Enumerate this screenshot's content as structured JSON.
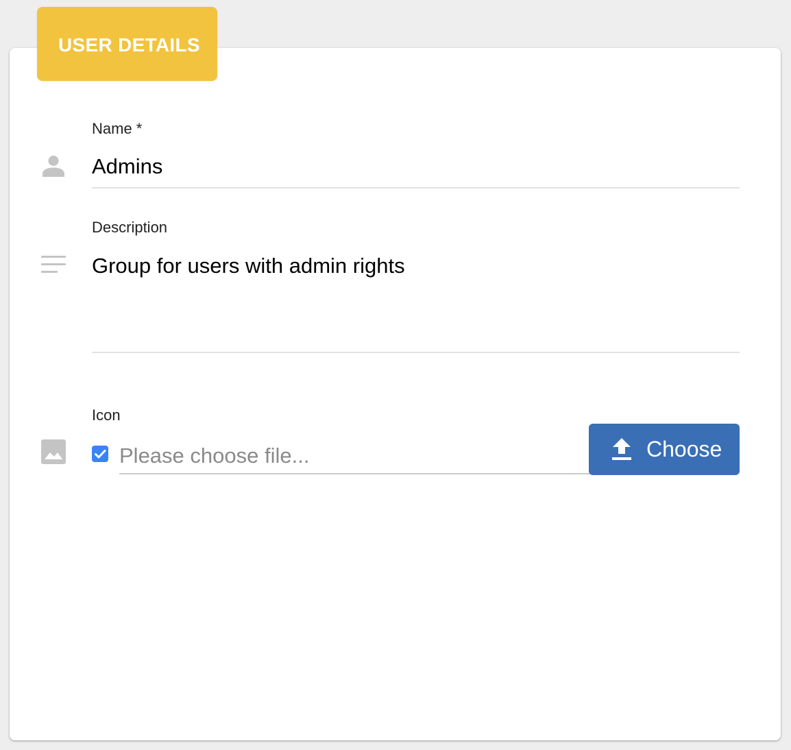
{
  "section": {
    "title": "USER DETAILS"
  },
  "fields": {
    "name": {
      "label": "Name *",
      "value": "Admins",
      "icon": "person-icon"
    },
    "description": {
      "label": "Description",
      "value": "Group for users with admin rights",
      "icon": "notes-icon"
    },
    "icon": {
      "label": "Icon",
      "placeholder": "Please choose file...",
      "checkbox_checked": true,
      "icon": "image-icon",
      "button_label": "Choose",
      "button_icon": "upload-icon"
    }
  },
  "colors": {
    "header_accent": "#f2c33f",
    "button": "#3a6fb5",
    "checkbox": "#3b82f6",
    "icon_gray": "#c4c4c4"
  }
}
